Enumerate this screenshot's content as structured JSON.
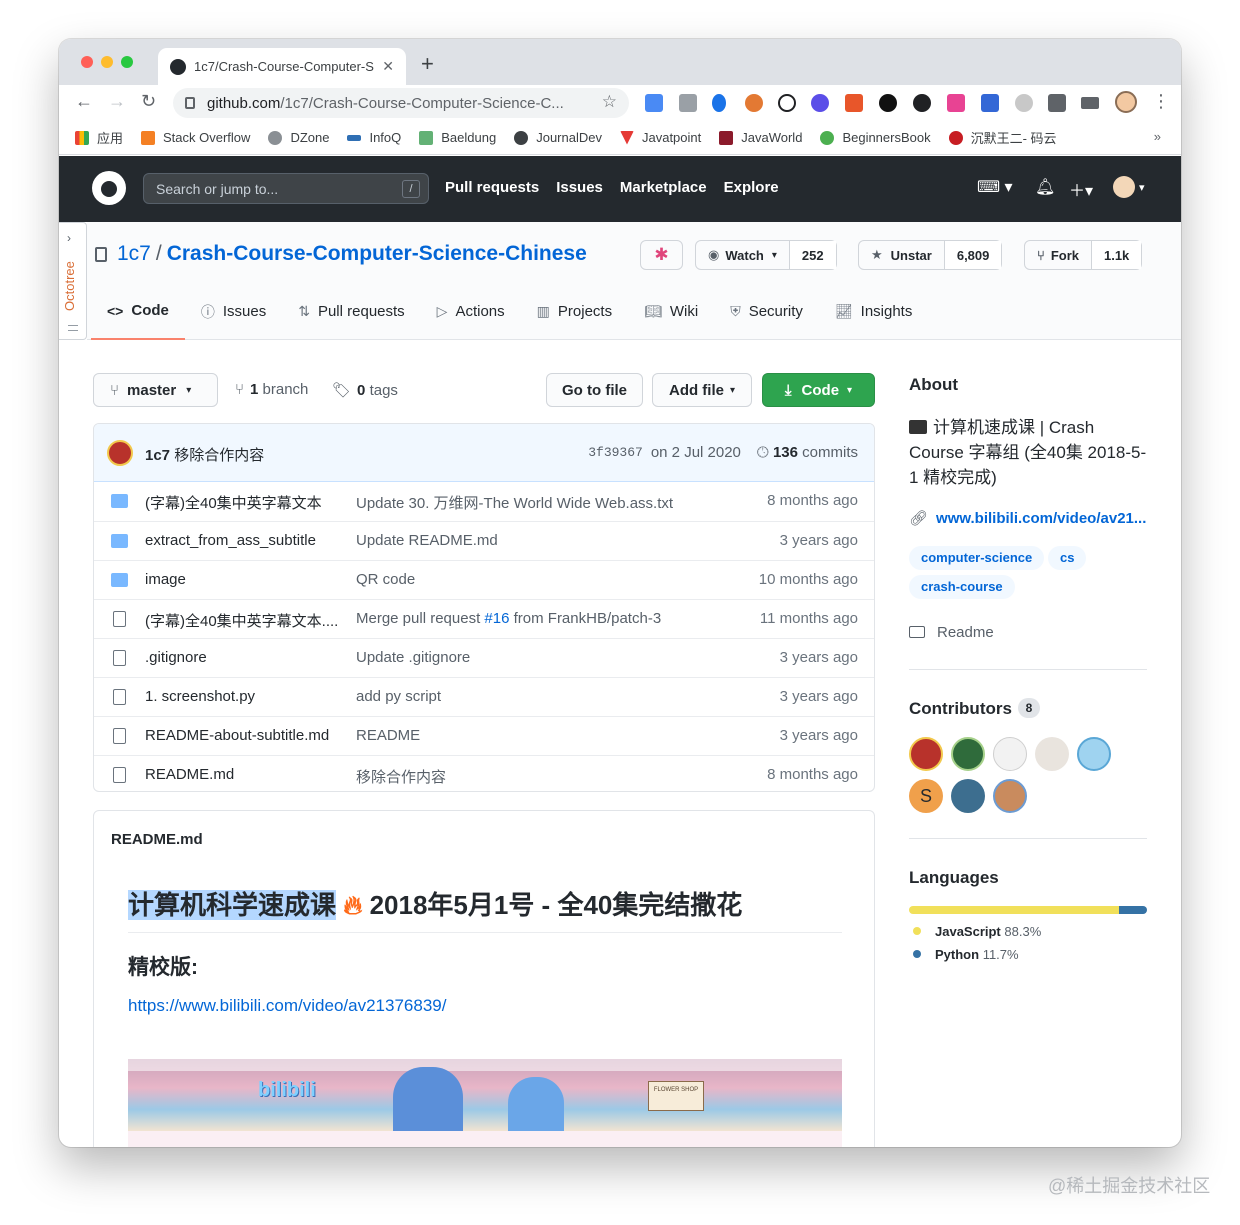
{
  "browser": {
    "tab_title": "1c7/Crash-Course-Computer-S",
    "url_host": "github.com",
    "url_path": "/1c7/Crash-Course-Computer-Science-C...",
    "bookmarks": [
      "应用",
      "Stack Overflow",
      "DZone",
      "InfoQ",
      "Baeldung",
      "JournalDev",
      "Javatpoint",
      "JavaWorld",
      "BeginnersBook",
      "沉默王二- 码云"
    ],
    "bookmarks_more": "»"
  },
  "github_header": {
    "search_placeholder": "Search or jump to...",
    "search_key": "/",
    "nav": [
      "Pull requests",
      "Issues",
      "Marketplace",
      "Explore"
    ]
  },
  "octotree": {
    "label": "Octotree"
  },
  "repo": {
    "owner": "1c7",
    "name": "Crash-Course-Computer-Science-Chinese",
    "watch_label": "Watch",
    "watch_count": "252",
    "star_label": "Unstar",
    "star_count": "6,809",
    "fork_label": "Fork",
    "fork_count": "1.1k",
    "tabs": [
      "Code",
      "Issues",
      "Pull requests",
      "Actions",
      "Projects",
      "Wiki",
      "Security",
      "Insights"
    ]
  },
  "toolbar": {
    "branch": "master",
    "branch_count": "1",
    "branch_word": "branch",
    "tag_count": "0",
    "tag_word": "tags",
    "go_to_file": "Go to file",
    "add_file": "Add file",
    "code": "Code"
  },
  "commit": {
    "author": "1c7",
    "message": "移除合作内容",
    "sha": "3f39367",
    "date": "on 2 Jul 2020",
    "count": "136",
    "count_word": "commits"
  },
  "files": [
    {
      "name": "(字幕)全40集中英字幕文本",
      "type": "dir",
      "message": "Update 30. 万维网-The World Wide Web.ass.txt",
      "age": "8 months ago"
    },
    {
      "name": "extract_from_ass_subtitle",
      "type": "dir",
      "message": "Update README.md",
      "age": "3 years ago"
    },
    {
      "name": "image",
      "type": "dir",
      "message": "QR code",
      "age": "10 months ago"
    },
    {
      "name": "(字幕)全40集中英字幕文本....",
      "type": "file",
      "message": "Merge pull request",
      "message_link": "#16",
      "message_tail": "from FrankHB/patch-3",
      "age": "11 months ago"
    },
    {
      "name": ".gitignore",
      "type": "file",
      "message": "Update .gitignore",
      "age": "3 years ago"
    },
    {
      "name": "1. screenshot.py",
      "type": "file",
      "message": "add py script",
      "age": "3 years ago"
    },
    {
      "name": "README-about-subtitle.md",
      "type": "file",
      "message": "README",
      "age": "3 years ago"
    },
    {
      "name": "README.md",
      "type": "file",
      "message": "移除合作内容",
      "age": "8 months ago"
    }
  ],
  "readme": {
    "filename": "README.md",
    "h1_highlight": "计算机科学速成课",
    "h1_rest": "2018年5月1号 - 全40集完结撒花",
    "h3": "精校版:",
    "link": "https://www.bilibili.com/video/av21376839/",
    "banner_logo": "bilibili",
    "banner_shop": "FLOWER SHOP"
  },
  "about": {
    "heading": "About",
    "description": "计算机速成课 | Crash Course 字幕组 (全40集 2018-5-1 精校完成)",
    "link": "www.bilibili.com/video/av21...",
    "topics": [
      "computer-science",
      "cs",
      "crash-course"
    ],
    "readme_label": "Readme"
  },
  "contributors": {
    "heading": "Contributors",
    "count": "8",
    "initial": "S"
  },
  "languages": {
    "heading": "Languages",
    "items": [
      {
        "name": "JavaScript",
        "percent": "88.3%",
        "value": 88.3,
        "color": "#f1e05a"
      },
      {
        "name": "Python",
        "percent": "11.7%",
        "value": 11.7,
        "color": "#3572A5"
      }
    ]
  },
  "watermark": "@稀土掘金技术社区",
  "colors": {
    "header_bg": "#24292e",
    "link": "#0366d6",
    "code_button": "#2ea44f",
    "active_tab_underline": "#f9826c"
  }
}
